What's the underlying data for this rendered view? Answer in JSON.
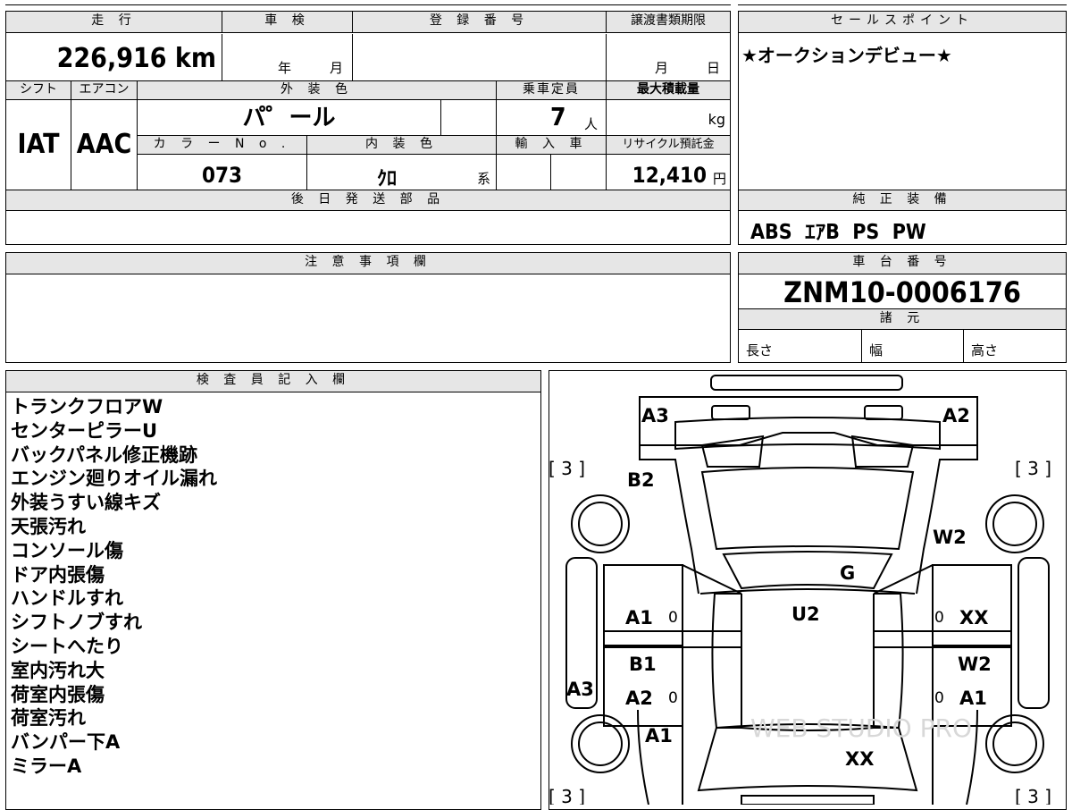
{
  "sheet": {
    "mileage": {
      "label": "走 行",
      "value": "226,916 km"
    },
    "inspection": {
      "label": "車 検",
      "year_unit": "年",
      "month_unit": "月"
    },
    "registration": {
      "label": "登 録 番 号",
      "value": ""
    },
    "transfer": {
      "label": "譲渡書類期限",
      "month_unit": "月",
      "day_unit": "日"
    },
    "shift": {
      "label": "シフト",
      "value": "IAT"
    },
    "aircon": {
      "label": "エアコン",
      "value": "AAC"
    },
    "exterior": {
      "label": "外 装 色",
      "value": "パ゜ール"
    },
    "capacity": {
      "label": "乗車定員",
      "value": "7",
      "unit": "人"
    },
    "max_load": {
      "label": "最大積載量",
      "unit": "kg"
    },
    "color_no": {
      "label": "カ ラ ー N o .",
      "value": "073"
    },
    "interior": {
      "label": "内 装 色",
      "value": "ｸﾛ",
      "suffix": "系"
    },
    "import": {
      "label": "輸 入 車"
    },
    "recycle": {
      "label": "リサイクル預託金",
      "value": "12,410",
      "unit": "円"
    },
    "later_parts": {
      "label": "後 日 発 送 部 品"
    },
    "sales_point": {
      "label": "セールスポイント",
      "value": "★オークションデビュー★"
    },
    "equipment": {
      "label": "純 正 装 備",
      "value": "ABS  ｴｱB  PS  PW"
    },
    "caution": {
      "label": "注 意 事 項 欄"
    },
    "chassis": {
      "label": "車 台 番 号",
      "value": "ZNM10-0006176"
    },
    "specs": {
      "label": "諸 元",
      "length": "長さ",
      "width": "幅",
      "height": "高さ"
    },
    "inspector": {
      "label": "検 査 員 記 入 欄",
      "notes": [
        "トランクフロアW",
        "センターピラーU",
        "バックパネル修正機跡",
        "エンジン廻りオイル漏れ",
        "外装うすい線キズ",
        "天張汚れ",
        "コンソール傷",
        "ドア内張傷",
        "ハンドルすれ",
        "シフトノブすれ",
        "シートへたり",
        "室内汚れ大",
        "荷室内張傷",
        "荷室汚れ",
        "バンパー下A",
        "ミラーA"
      ]
    }
  },
  "diagram": {
    "marks": {
      "a3_top": "A3",
      "a2_top": "A2",
      "b2": "B2",
      "w2_right": "W2",
      "g": "G",
      "u2": "U2",
      "a1_left": "A1",
      "xx_right": "XX",
      "b1": "B1",
      "w2_right2": "W2",
      "a3_left": "A3",
      "a2_left": "A2",
      "a1_right": "A1",
      "a1_bottom": "A1",
      "xx_bottom": "XX"
    },
    "tires": {
      "tl": "[ 3 ]",
      "tr": "[ 3 ]",
      "bl": "[ 3 ]",
      "br": "[ 3 ]"
    },
    "zeros": {
      "l1": "0",
      "r1": "0",
      "l2": "0",
      "r2": "0"
    },
    "watermark": "WEB STUDIO PRO"
  }
}
